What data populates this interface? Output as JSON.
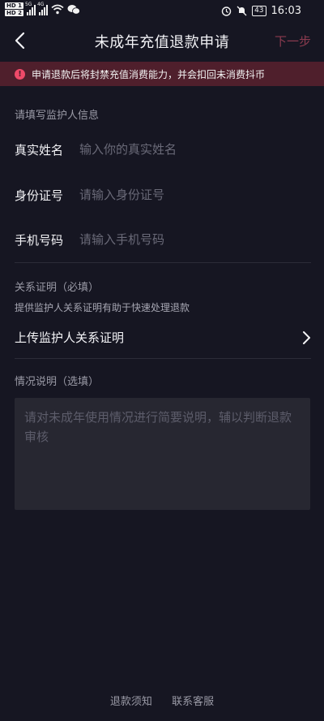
{
  "status_bar": {
    "hd1": "HD 1",
    "hd2": "HD 2",
    "sig1": "5G",
    "sig2": "4G",
    "battery": "43",
    "time": "16:03"
  },
  "nav": {
    "title": "未成年充值退款申请",
    "next_label": "下一步"
  },
  "warning": {
    "icon": "!",
    "text": "申请退款后将封禁充值消费能力，并会扣回未消费抖币"
  },
  "guardian_section": {
    "label": "请填写监护人信息",
    "fields": [
      {
        "label": "真实姓名",
        "placeholder": "输入你的真实姓名",
        "value": ""
      },
      {
        "label": "身份证号",
        "placeholder": "请输入身份证号",
        "value": ""
      },
      {
        "label": "手机号码",
        "placeholder": "请输入手机号码",
        "value": ""
      }
    ]
  },
  "relation_section": {
    "label": "关系证明（必填）",
    "helper": "提供监护人关系证明有助于快速处理退款",
    "upload_label": "上传监护人关系证明"
  },
  "description_section": {
    "label": "情况说明（选填）",
    "placeholder": "请对未成年使用情况进行简要说明，辅以判断退款审核",
    "value": ""
  },
  "footer": {
    "refund_notice": "退款须知",
    "contact_service": "联系客服"
  },
  "colors": {
    "background": "#161622",
    "warning_bg": "#4f1f2c",
    "warning_icon": "#f04a69",
    "next_text": "#8c3b4f"
  }
}
